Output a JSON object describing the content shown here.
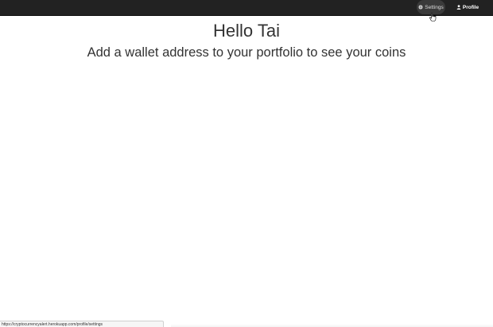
{
  "navbar": {
    "settings": {
      "label": "Settings",
      "icon": "gear-icon"
    },
    "profile": {
      "label": "Profile",
      "icon": "user-icon"
    }
  },
  "main": {
    "greeting": "Hello Tai",
    "subheading": "Add a wallet address to your portfolio to see your coins"
  },
  "status_bar": {
    "url": "https://cryptocurrencyalert.herokuapp.com/profile/settings"
  },
  "colors": {
    "navbar_bg": "#222222",
    "text": "#333333"
  }
}
